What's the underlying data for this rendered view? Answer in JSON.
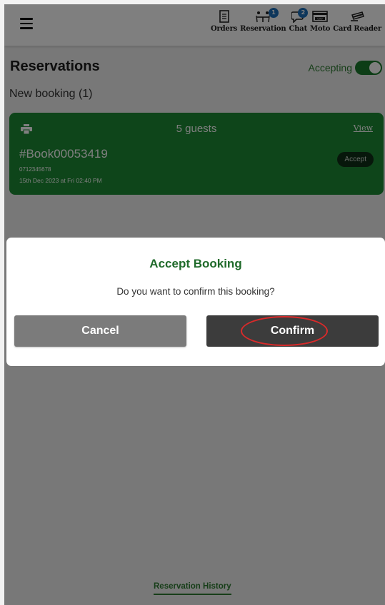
{
  "topbar": {
    "menu_icon": "hamburger-menu-icon",
    "nav": [
      {
        "label": "Orders",
        "icon": "receipt-icon"
      },
      {
        "label": "Reservation",
        "icon": "dining-table-icon",
        "badge": "1"
      },
      {
        "label": "Chat",
        "icon": "chat-bubble-icon",
        "badge": "2"
      },
      {
        "label": "Moto",
        "icon": "cvv-card-icon",
        "icon_text": "CVV"
      },
      {
        "label": "Card Reader",
        "icon": "card-reader-icon"
      }
    ]
  },
  "page": {
    "title": "Reservations",
    "accepting_label": "Accepting",
    "accepting_on": true,
    "new_booking_label": "New booking (1)"
  },
  "booking": {
    "guests": "5 guests",
    "view_label": "View",
    "ref": "#Book00053419",
    "phone": "0712345678",
    "datetime": "15th Dec 2023 at Fri 02:40 PM",
    "accept_label": "Accept"
  },
  "footer": {
    "history_label": "Reservation History"
  },
  "dialog": {
    "title": "Accept Booking",
    "message": "Do you want to confirm this booking?",
    "cancel_label": "Cancel",
    "confirm_label": "Confirm"
  },
  "colors": {
    "brand_green": "#1d8a34",
    "title_green": "#1f6a2a",
    "badge_blue": "#1d6fb8",
    "highlight_red": "#d92a2a"
  }
}
